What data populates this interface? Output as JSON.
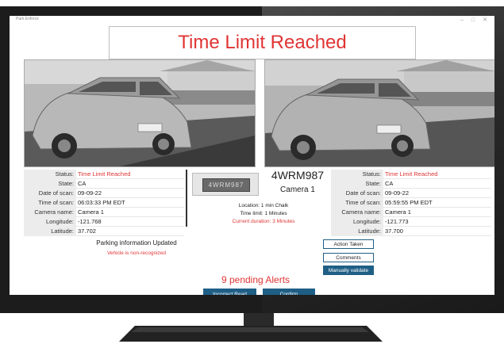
{
  "window": {
    "title": "Park Enforce"
  },
  "header": {
    "banner": "Time Limit Reached"
  },
  "left_record": {
    "rows": [
      {
        "label": "Status:",
        "value": "Time Limit Reached",
        "highlight": true
      },
      {
        "label": "State:",
        "value": "CA"
      },
      {
        "label": "Date of scan:",
        "value": "09-09-22"
      },
      {
        "label": "Time of scan:",
        "value": "06:03:33 PM EDT"
      },
      {
        "label": "Camera name:",
        "value": "Camera 1"
      },
      {
        "label": "Longitude:",
        "value": "-121.768"
      },
      {
        "label": "Latitude:",
        "value": "37.702"
      }
    ]
  },
  "right_record": {
    "rows": [
      {
        "label": "Status:",
        "value": "Time Limit Reached",
        "highlight": true
      },
      {
        "label": "State:",
        "value": "CA"
      },
      {
        "label": "Date of scan:",
        "value": "09-09-22"
      },
      {
        "label": "Time of scan:",
        "value": "05:59:55 PM EDT"
      },
      {
        "label": "Camera name:",
        "value": "Camera 1"
      },
      {
        "label": "Longitude:",
        "value": "-121.773"
      },
      {
        "label": "Latitude:",
        "value": "37.700"
      }
    ]
  },
  "plate": {
    "crop_text": "4WRM987",
    "number": "4WRM987",
    "camera": "Camera 1",
    "location": "Location: 1 min Chalk",
    "time_limit": "Time limit: 1 Minutes",
    "current_duration": "Current duration: 3 Minutes"
  },
  "status": {
    "parking_info": "Parking information Updated",
    "vehicle": "Vehicle is non-recognized"
  },
  "actions": {
    "action_taken": "Action Taken",
    "comments": "Comments",
    "manually_validate": "Manually validate"
  },
  "footer": {
    "pending_alerts": "9 pending Alerts",
    "incorrect_read": "Incorrect Read",
    "confirm": "Confirm"
  },
  "icons": {
    "minimize": "minimize-icon",
    "maximize": "maximize-icon",
    "close": "close-icon"
  },
  "colors": {
    "alert": "#e03434",
    "button": "#1f5f86"
  }
}
